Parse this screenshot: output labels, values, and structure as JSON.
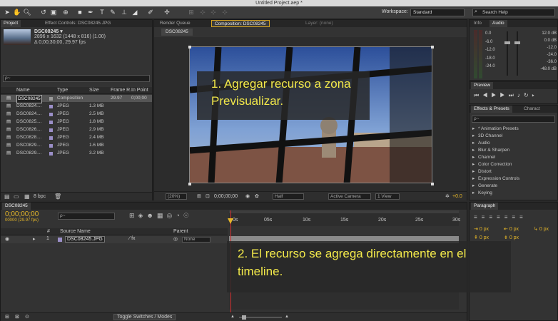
{
  "window": {
    "title": "Untitled Project.aep *"
  },
  "toolbar": {
    "workspace_label": "Workspace:",
    "workspace_value": "Standard",
    "search_placeholder": "Search Help"
  },
  "project_panel": {
    "tabs": [
      "Project",
      "Effect Controls: DSC08245.JPG"
    ],
    "item_name": "DSC08245 ▾",
    "item_dims": "2896 x 1632  (1448 x 816) (1.00)",
    "item_duration": "Δ 0;00;30;00, 29.97 fps",
    "search_placeholder": "ρ~",
    "columns": [
      "Name",
      "Type",
      "Size",
      "Frame R...",
      "In Point"
    ],
    "rows": [
      {
        "name": "DSC08245",
        "type": "Composition",
        "size": "",
        "fps": "29.97",
        "in": "0;00;00",
        "color": "#9a9a9a",
        "selected": true
      },
      {
        "name": "DSC0824....",
        "type": "JPEG",
        "size": "1.3 MB",
        "fps": "",
        "in": "",
        "color": "#9b8fc8",
        "selected": false
      },
      {
        "name": "DSC0824....",
        "type": "JPEG",
        "size": "2.5 MB",
        "fps": "",
        "in": "",
        "color": "#9b8fc8",
        "selected": false
      },
      {
        "name": "DSC0825....",
        "type": "JPEG",
        "size": "1.8 MB",
        "fps": "",
        "in": "",
        "color": "#9b8fc8",
        "selected": false
      },
      {
        "name": "DSC0826....",
        "type": "JPEG",
        "size": "2.9 MB",
        "fps": "",
        "in": "",
        "color": "#9b8fc8",
        "selected": false
      },
      {
        "name": "DSC0828....",
        "type": "JPEG",
        "size": "2.4 MB",
        "fps": "",
        "in": "",
        "color": "#9b8fc8",
        "selected": false
      },
      {
        "name": "DSC0829....",
        "type": "JPEG",
        "size": "1.6 MB",
        "fps": "",
        "in": "",
        "color": "#9b8fc8",
        "selected": false
      },
      {
        "name": "DSC0829....",
        "type": "JPEG",
        "size": "3.2 MB",
        "fps": "",
        "in": "",
        "color": "#9b8fc8",
        "selected": false
      }
    ],
    "bpc": "8 bpc"
  },
  "comp_panel": {
    "tabs": [
      "Render Queue",
      "Composition: DSC08245",
      "Layer: (none)"
    ],
    "comp_tab": "DSC08245",
    "zoom": "(20%)",
    "timecode": "0;00;00;00",
    "resolution": "Half",
    "camera": "Active Camera",
    "views": "1 View",
    "exposure": "+0.0"
  },
  "info_panel": {
    "tabs": [
      "Info",
      "Audio"
    ],
    "left_scale": [
      "0.0",
      "-6.0",
      "-12.0",
      "-18.0",
      "-24.0"
    ],
    "right_scale": [
      "12.0 dB",
      "0.0 dB",
      "-12.0",
      "-24.0",
      "-36.0",
      "-48.0 dB"
    ]
  },
  "preview_panel": {
    "title": "Preview"
  },
  "effects_panel": {
    "tabs": [
      "Effects & Presets",
      "Charact"
    ],
    "search_placeholder": "ρ~",
    "items": [
      "* Animation Presets",
      "3D Channel",
      "Audio",
      "Blur & Sharpen",
      "Channel",
      "Color Correction",
      "Distort",
      "Expression Controls",
      "Generate",
      "Keying"
    ]
  },
  "timeline": {
    "tab": "DSC08245",
    "timecode": "0;00;00;00",
    "frame_info": "00000 (29.97 fps)",
    "search_placeholder": "ρ~",
    "columns": [
      "#",
      "Source Name",
      "Parent"
    ],
    "layer": {
      "num": "1",
      "name": "DSC08245.JPG",
      "parent": "None"
    },
    "ruler": [
      "0s",
      "05s",
      "10s",
      "15s",
      "20s",
      "25s",
      "30s"
    ],
    "toggle_label": "Toggle Switches / Modes"
  },
  "paragraph_panel": {
    "title": "Paragraph",
    "values": [
      "0 px",
      "0 px",
      "0 px",
      "0 px",
      "0 px"
    ]
  },
  "annotations": {
    "step1": "1. Agregar recurso a zona Previsualizar.",
    "step2": "2. El recurso se agrega directamente en el timeline."
  }
}
